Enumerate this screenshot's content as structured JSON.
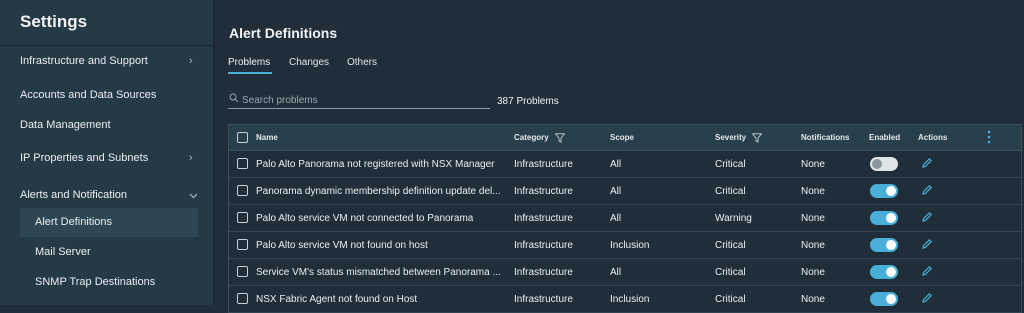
{
  "sidebar": {
    "title": "Settings",
    "items": [
      {
        "label": "Infrastructure and Support",
        "chevron": "chevron-right"
      },
      {
        "label": "Accounts and Data Sources"
      },
      {
        "label": "Data Management"
      },
      {
        "label": "IP Properties and Subnets",
        "chevron": "chevron-right"
      },
      {
        "label": "Alerts and Notification",
        "chevron": "chevron-down"
      }
    ],
    "subitems": [
      {
        "label": "Alert Definitions",
        "active": true
      },
      {
        "label": "Mail Server"
      },
      {
        "label": "SNMP Trap Destinations"
      }
    ]
  },
  "main": {
    "title": "Alert Definitions",
    "tabs": [
      {
        "label": "Problems",
        "active": true
      },
      {
        "label": "Changes"
      },
      {
        "label": "Others"
      }
    ],
    "search": {
      "placeholder": "Search problems",
      "value": ""
    },
    "count_label": "387 Problems"
  },
  "table": {
    "columns": {
      "name": "Name",
      "category": "Category",
      "scope": "Scope",
      "severity": "Severity",
      "notifications": "Notifications",
      "enabled": "Enabled",
      "actions": "Actions"
    },
    "rows": [
      {
        "name": "Palo Alto Panorama not registered with NSX Manager",
        "category": "Infrastructure",
        "scope": "All",
        "severity": "Critical",
        "notifications": "None",
        "enabled": false
      },
      {
        "name": "Panorama dynamic membership definition update del...",
        "category": "Infrastructure",
        "scope": "All",
        "severity": "Critical",
        "notifications": "None",
        "enabled": true
      },
      {
        "name": "Palo Alto service VM not connected to Panorama",
        "category": "Infrastructure",
        "scope": "All",
        "severity": "Warning",
        "notifications": "None",
        "enabled": true
      },
      {
        "name": "Palo Alto service VM not found on host",
        "category": "Infrastructure",
        "scope": "Inclusion",
        "severity": "Critical",
        "notifications": "None",
        "enabled": true
      },
      {
        "name": "Service VM's status mismatched between Panorama ...",
        "category": "Infrastructure",
        "scope": "All",
        "severity": "Critical",
        "notifications": "None",
        "enabled": true
      },
      {
        "name": "NSX Fabric Agent not found on Host",
        "category": "Infrastructure",
        "scope": "Inclusion",
        "severity": "Critical",
        "notifications": "None",
        "enabled": true
      }
    ]
  },
  "colors": {
    "accent": "#49afd9",
    "background": "#1f2e38",
    "sidebar": "#263a46",
    "active_item": "#2f4654"
  }
}
